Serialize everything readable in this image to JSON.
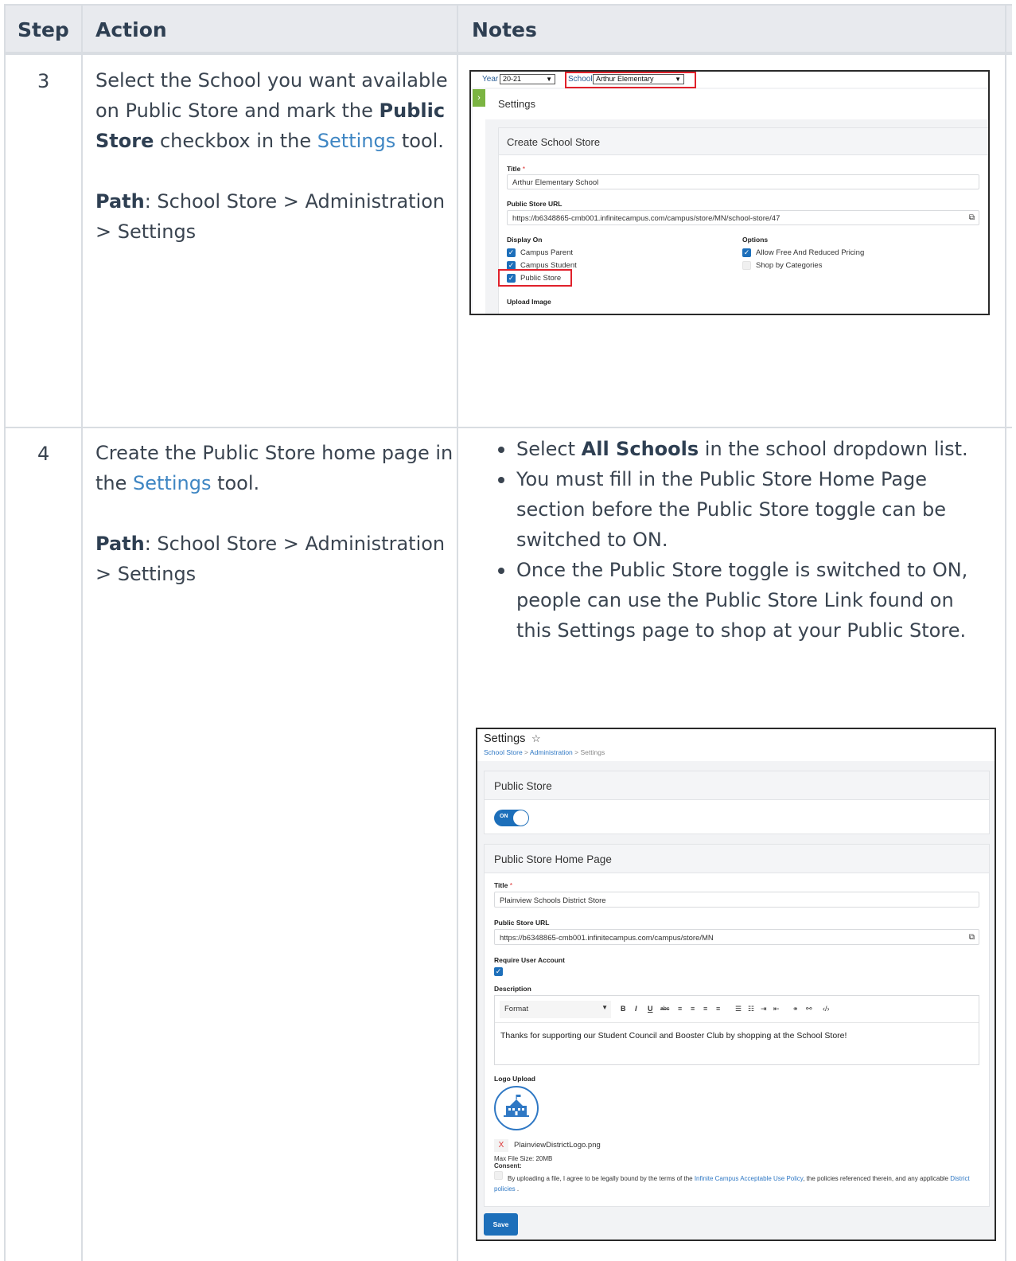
{
  "table": {
    "headers": {
      "step": "Step",
      "action": "Action",
      "notes": "Notes"
    },
    "rows": [
      {
        "step": "3",
        "action_pre": "Select the School you want available on Public Store and mark the ",
        "action_bold": "Public Store",
        "action_mid": " checkbox in the ",
        "action_link": "Settings",
        "action_post": " tool.",
        "path_label": "Path",
        "path_text": ": School Store > Administration > Settings"
      },
      {
        "step": "4",
        "action_pre": "Create the Public Store home page in the ",
        "action_link": "Settings",
        "action_post": " tool.",
        "path_label": "Path",
        "path_text": ": School Store > Administration > Settings",
        "notes": {
          "b1_pre": "Select ",
          "b1_bold": "All Schools",
          "b1_post": " in the school dropdown list.",
          "b2": "You must fill in the Public Store Home Page section before the Public Store toggle can be switched to ON.",
          "b3": "Once the Public Store toggle is switched to ON, people can use the Public Store Link found on this Settings page to shop at your Public Store."
        }
      }
    ]
  },
  "screenshot1": {
    "year_label": "Year",
    "year_value": "20-21",
    "school_label": "School",
    "school_value": "Arthur Elementary",
    "nav_arrow": "›",
    "page_title": "Settings",
    "panel_title": "Create School Store",
    "title_label": "Title",
    "required_mark": "*",
    "title_value": "Arthur Elementary School",
    "url_label": "Public Store URL",
    "url_value": "https://b6348865-cmb001.infinitecampus.com/campus/store/MN/school-store/47",
    "display_on_label": "Display On",
    "display_on": [
      {
        "label": "Campus Parent",
        "checked": true
      },
      {
        "label": "Campus Student",
        "checked": true
      },
      {
        "label": "Public Store",
        "checked": true
      }
    ],
    "options_label": "Options",
    "options": [
      {
        "label": "Allow Free And Reduced Pricing",
        "checked": true
      },
      {
        "label": "Shop by Categories",
        "checked": false
      }
    ],
    "upload_label": "Upload Image",
    "highlight_color": "#e0212b"
  },
  "screenshot2": {
    "title": "Settings",
    "star": "☆",
    "crumb1": "School Store",
    "crumb2": "Administration",
    "crumb3": "Settings",
    "crumb_sep": ">",
    "public_store_header": "Public Store",
    "toggle_text": "ON",
    "toggle_on": true,
    "home_header": "Public Store Home Page",
    "title_label": "Title",
    "required_mark": "*",
    "title_value": "Plainview Schools District Store",
    "url_label": "Public Store URL",
    "url_value": "https://b6348865-cmb001.infinitecampus.com/campus/store/MN",
    "require_label": "Require User Account",
    "require_checked": true,
    "description_label": "Description",
    "format_value": "Format",
    "description_text": "Thanks for supporting our Student Council and Booster Club by shopping at the School Store!",
    "logo_label": "Logo Upload",
    "remove_mark": "X",
    "file_name": "PlainviewDistrictLogo.png",
    "max_size": "Max File Size: 20MB",
    "consent_label": "Consent:",
    "consent_pre": "By uploading a file, I agree to be legally bound by the terms of the ",
    "consent_link1": "Infinite Campus Acceptable Use Policy",
    "consent_mid": ", the policies referenced therein, and any applicable ",
    "consent_link2": "District policies",
    "consent_post": " .",
    "save_label": "Save",
    "accent_color": "#1d6fba"
  }
}
